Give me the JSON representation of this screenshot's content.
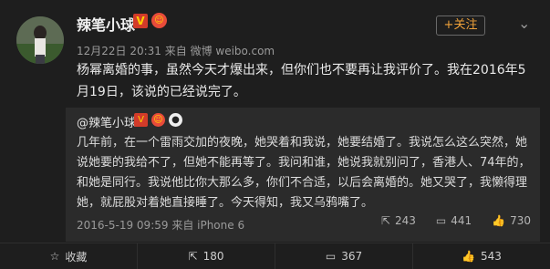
{
  "user": {
    "name": "辣笔小球"
  },
  "follow_label": "关注",
  "post": {
    "meta": "12月22日 20:31 来自 微博 weibo.com",
    "text": "杨幂离婚的事，虽然今天才爆出来，但你们也不要再让我评价了。我在2016年5月19日，该说的已经说完了。"
  },
  "quote": {
    "author": "@辣笔小球",
    "text": "几年前，在一个雷雨交加的夜晚，她哭着和我说，她要结婚了。我说怎么这么突然，她说她要的我给不了，但她不能再等了。我问和谁，她说我就别问了，香港人、74年的，和她是同行。我说他比你大那么多，你们不合适，以后会离婚的。她又哭了，我懒得理她，就屁股对着她直接睡了。今天得知，我又乌鸦嘴了。",
    "meta": "2016-5-19 09:59 来自 iPhone 6",
    "stats": {
      "repost": "243",
      "comment": "441",
      "like": "730"
    }
  },
  "actions": {
    "favorite": "收藏",
    "repost": "180",
    "comment": "367",
    "like": "543"
  },
  "colors": {
    "accent": "#f0a23a",
    "badge_red": "#d23b2a"
  }
}
